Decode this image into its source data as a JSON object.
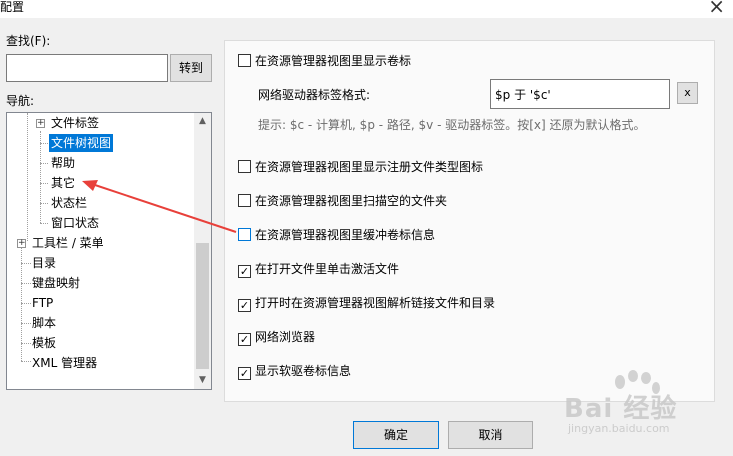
{
  "window": {
    "title": "配置",
    "close_icon": "×"
  },
  "search": {
    "label": "查找(F):",
    "value": "",
    "placeholder": "",
    "goto_label": "转到"
  },
  "nav": {
    "label": "导航:",
    "items": [
      {
        "label": "文件标签",
        "expanded": false
      },
      {
        "label": "文件树视图",
        "selected": true
      },
      {
        "label": "帮助"
      },
      {
        "label": "其它"
      },
      {
        "label": "状态栏"
      },
      {
        "label": "窗口状态"
      },
      {
        "label": "工具栏 / 菜单",
        "expanded": false
      },
      {
        "label": "目录"
      },
      {
        "label": "键盘映射"
      },
      {
        "label": "FTP"
      },
      {
        "label": "脚本"
      },
      {
        "label": "模板"
      },
      {
        "label": "XML 管理器"
      }
    ]
  },
  "settings": {
    "show_volume_label": {
      "label": "在资源管理器视图里显示卷标",
      "checked": false
    },
    "network_drive_format": {
      "label": "网络驱动器标签格式:",
      "value": "$p 于 '$c'",
      "clear_label": "x"
    },
    "hint": "提示: $c - 计算机, $p - 路径, $v - 驱动器标签。按[x] 还原为默认格式。",
    "show_registered_icons": {
      "label": "在资源管理器视图里显示注册文件类型图标",
      "checked": false
    },
    "scan_empty_folders": {
      "label": "在资源管理器视图里扫描空的文件夹",
      "checked": false
    },
    "cache_volume_info": {
      "label": "在资源管理器视图里缓冲卷标信息",
      "checked": false
    },
    "single_click_activate": {
      "label": "在打开文件里单击激活文件",
      "checked": true
    },
    "resolve_links": {
      "label": "打开时在资源管理器视图解析链接文件和目录",
      "checked": true
    },
    "network_browser": {
      "label": "网络浏览器",
      "checked": true
    },
    "show_floppy_label": {
      "label": "显示软驱卷标信息",
      "checked": true
    }
  },
  "footer": {
    "ok_label": "确定",
    "cancel_label": "取消"
  },
  "watermark": {
    "main": "Bai 经验",
    "sub": "jingyan.baidu.com"
  },
  "colors": {
    "selection": "#0078d7",
    "annotation_arrow": "#e8403a",
    "window_bg": "#f0f0f0"
  }
}
